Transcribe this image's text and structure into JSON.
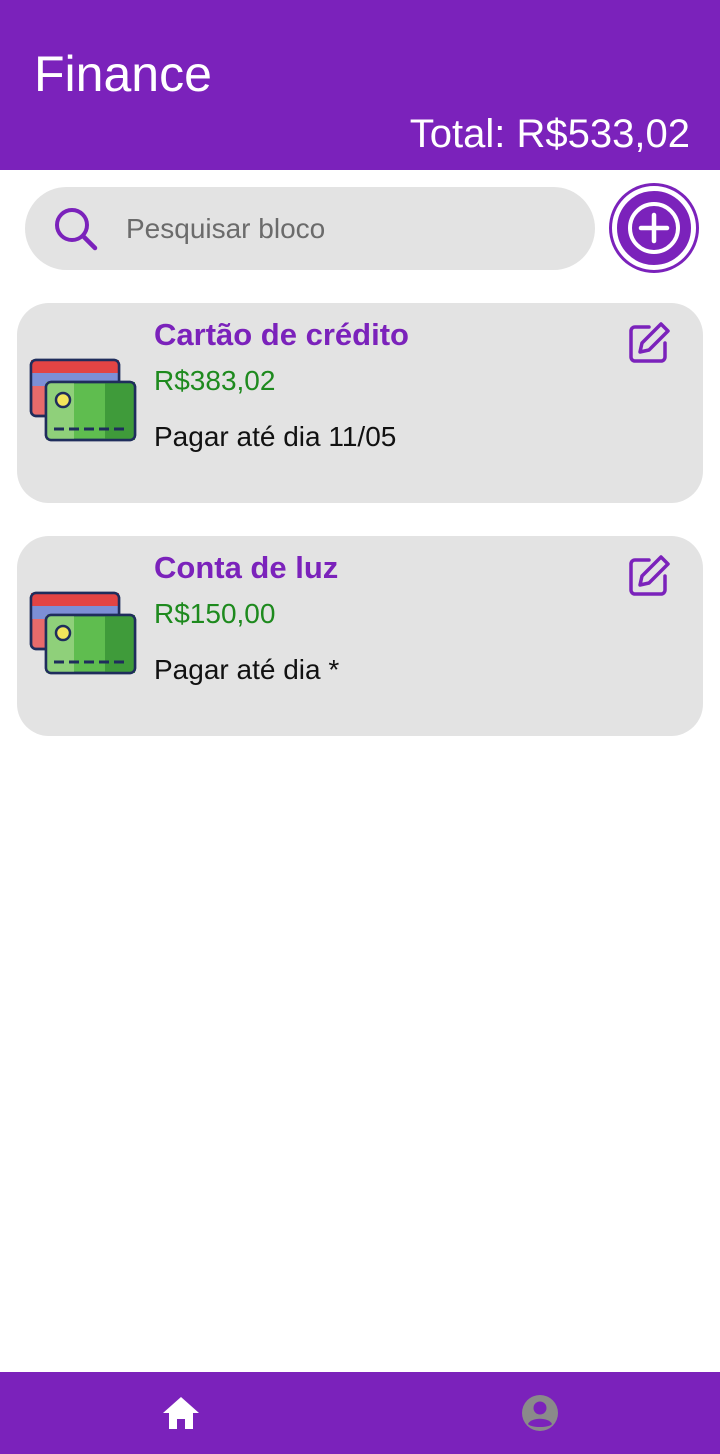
{
  "header": {
    "title": "Finance",
    "total": "Total: R$533,02"
  },
  "search": {
    "placeholder": "Pesquisar bloco",
    "value": ""
  },
  "add_button": {
    "icon": "plus-circle-icon"
  },
  "cards": [
    {
      "title": "Cartão de crédito",
      "amount": "R$383,02",
      "due": "Pagar até dia 11/05",
      "icon": "credit-cards-icon"
    },
    {
      "title": "Conta de luz",
      "amount": "R$150,00",
      "due": "Pagar até dia *",
      "icon": "credit-cards-icon"
    }
  ],
  "bottom_nav": {
    "items": [
      {
        "icon": "home-icon"
      },
      {
        "icon": "account-circle-icon"
      }
    ]
  },
  "colors": {
    "brand_purple": "#7b22bb",
    "amount_green": "#1e8a1e",
    "card_background": "#e3e3e3",
    "inactive_nav_icon": "#8a8a8a"
  }
}
